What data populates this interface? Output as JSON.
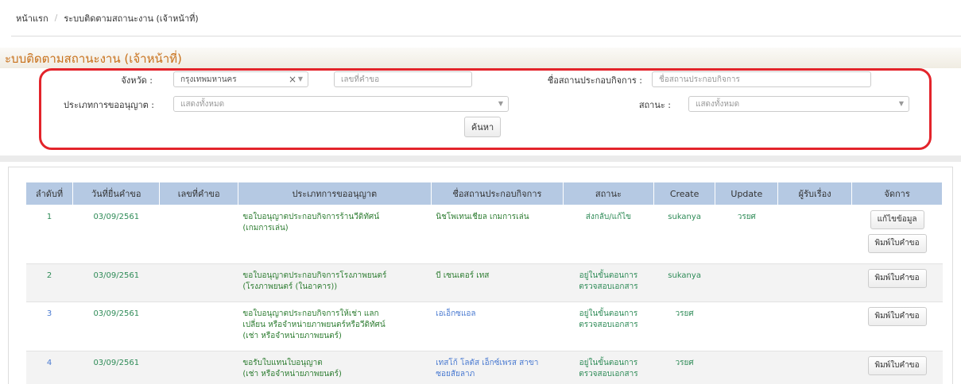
{
  "breadcrumb": {
    "home": "หน้าแรก",
    "separator": "/",
    "current": "ระบบติดตามสถานะงาน (เจ้าหน้าที่)"
  },
  "page_title": "ะบบติดตามสถานะงาน (เจ้าหน้าที่)",
  "filters": {
    "province_label": "จังหวัด :",
    "province_value": "กรุงเทพมหานคร",
    "request_no_placeholder": "เลขที่คำขอ",
    "business_name_label": "ชื่อสถานประกอบกิจการ :",
    "business_name_placeholder": "ชื่อสถานประกอบกิจการ",
    "license_type_label": "ประเภทการขออนุญาต :",
    "license_type_value": "แสดงทั้งหมด",
    "status_label": "สถานะ :",
    "status_value": "แสดงทั้งหมด",
    "search_button": "ค้นหา"
  },
  "table": {
    "headers": [
      "ลำดับที่",
      "วันที่ยื่นคำขอ",
      "เลขที่คำขอ",
      "ประเภทการขออนุญาต",
      "ชื่อสถานประกอบกิจการ",
      "สถานะ",
      "Create",
      "Update",
      "ผู้รับเรื่อง",
      "จัดการ"
    ],
    "rows": [
      {
        "no": "1",
        "date": "03/09/2561",
        "request_no": "",
        "type_line1": "ขอใบอนุญาตประกอบกิจการร้านวีดิทัศน์",
        "type_line2": "(เกมการเล่น)",
        "type_line3": "",
        "business_line1": "นิชโพเทนเชียล เกมการเล่น",
        "business_line2": "",
        "status_line1": "ส่งกลับ/แก้ไข",
        "status_line2": "",
        "create": "sukanya",
        "update": "วรยศ",
        "receiver": "",
        "action_edit": "แก้ไขข้อมูล",
        "action_print": "พิมพ์ใบคำขอ"
      },
      {
        "no": "2",
        "date": "03/09/2561",
        "request_no": "",
        "type_line1": "ขอใบอนุญาตประกอบกิจการโรงภาพยนตร์",
        "type_line2": "(โรงภาพยนตร์ (ในอาคาร))",
        "type_line3": "",
        "business_line1": "บี เซนเตอร์ เทส",
        "business_line2": "",
        "status_line1": "อยู่ในขั้นตอนการ",
        "status_line2": "ตรวจสอบเอกสาร",
        "create": "sukanya",
        "update": "",
        "receiver": "",
        "action_print": "พิมพ์ใบคำขอ"
      },
      {
        "no": "3",
        "date": "03/09/2561",
        "request_no": "",
        "type_line1": "ขอใบอนุญาตประกอบกิจการให้เช่า แลก",
        "type_line2": "เปลี่ยน หรือจำหน่ายภาพยนตร์หรือวีดิทัศน์",
        "type_line3": "(เช่า หรือจำหน่ายภาพยนตร์)",
        "business_line1": "เอเอ็กซแอล",
        "business_line2": "",
        "status_line1": "อยู่ในขั้นตอนการ",
        "status_line2": "ตรวจสอบเอกสาร",
        "create": "วรยศ",
        "update": "",
        "receiver": "",
        "action_print": "พิมพ์ใบคำขอ"
      },
      {
        "no": "4",
        "date": "03/09/2561",
        "request_no": "",
        "type_line1": "ขอรับใบแทนใบอนุญาต",
        "type_line2": "(เช่า หรือจำหน่ายภาพยนตร์)",
        "type_line3": "",
        "business_line1": "เทสโก้ โลตัส เอ็กซ์เพรส สาขา",
        "business_line2": "ซอยสัยลาภ",
        "status_line1": "อยู่ในขั้นตอนการ",
        "status_line2": "ตรวจสอบเอกสาร",
        "create": "วรยศ",
        "update": "",
        "receiver": "",
        "action_print": "พิมพ์ใบคำขอ"
      }
    ]
  }
}
